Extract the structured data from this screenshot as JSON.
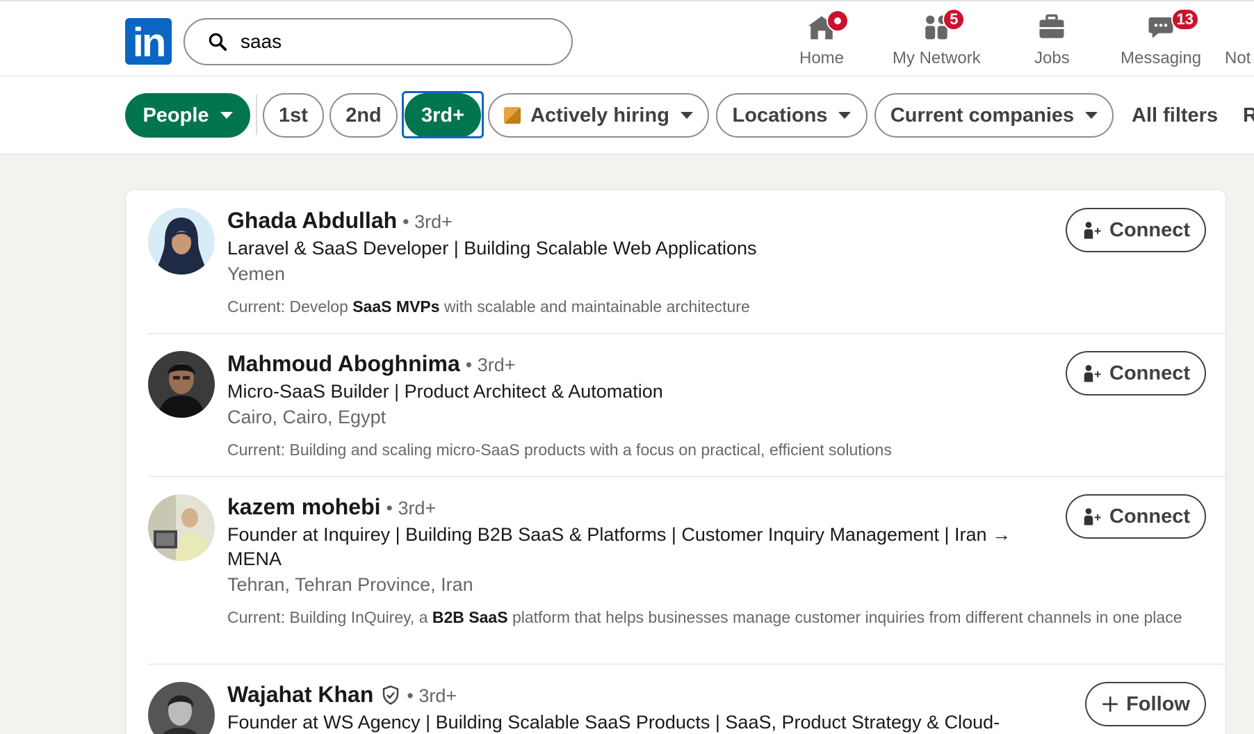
{
  "nav": {
    "search_value": "saas",
    "items": [
      {
        "label": "Home"
      },
      {
        "label": "My Network",
        "badge": "5"
      },
      {
        "label": "Jobs"
      },
      {
        "label": "Messaging",
        "badge": "13"
      },
      {
        "label": "Not"
      }
    ]
  },
  "filters": {
    "people": "People",
    "first": "1st",
    "second": "2nd",
    "third": "3rd+",
    "hiring": "Actively hiring",
    "locations": "Locations",
    "companies": "Current companies",
    "all_filters": "All filters",
    "reset": "R"
  },
  "results": [
    {
      "name": "Ghada Abdullah",
      "degree": "• 3rd+",
      "headline": "Laravel & SaaS Developer | Building Scalable Web Applications",
      "location": "Yemen",
      "current_prefix": "Current: Develop ",
      "current_bold": "SaaS MVPs",
      "current_suffix": " with scalable and maintainable architecture",
      "action": "Connect"
    },
    {
      "name": "Mahmoud Aboghnima",
      "degree": "• 3rd+",
      "headline": "Micro-SaaS Builder | Product Architect & Automation",
      "location": "Cairo, Cairo, Egypt",
      "current_prefix": "Current: Building and scaling micro-SaaS products with a focus on practical, efficient solutions",
      "current_bold": "",
      "current_suffix": "",
      "action": "Connect"
    },
    {
      "name": "kazem mohebi",
      "degree": "• 3rd+",
      "headline": "Founder at Inquirey | Building B2B SaaS & Platforms | Customer Inquiry Management | Iran → MENA",
      "location": "Tehran, Tehran Province, Iran",
      "current_prefix": "Current: Building InQuirey, a ",
      "current_bold": "B2B SaaS",
      "current_suffix": " platform that helps businesses manage customer inquiries from different channels in one place",
      "action": "Connect"
    },
    {
      "name": "Wajahat Khan",
      "degree": "• 3rd+",
      "headline": "Founder at WS Agency | Building Scalable SaaS Products | SaaS, Product Strategy & Cloud-",
      "location": "",
      "current_prefix": "",
      "current_bold": "",
      "current_suffix": "",
      "action": "Follow"
    }
  ],
  "colors": {
    "brand": "#0a66c2",
    "green_active": "#01754f",
    "badge": "#cb112d"
  },
  "icons": [
    "linkedin-logo",
    "search-icon",
    "home-icon",
    "my-network-icon",
    "jobs-icon",
    "messaging-icon",
    "connect-person-icon",
    "plus-icon",
    "verified-icon"
  ]
}
